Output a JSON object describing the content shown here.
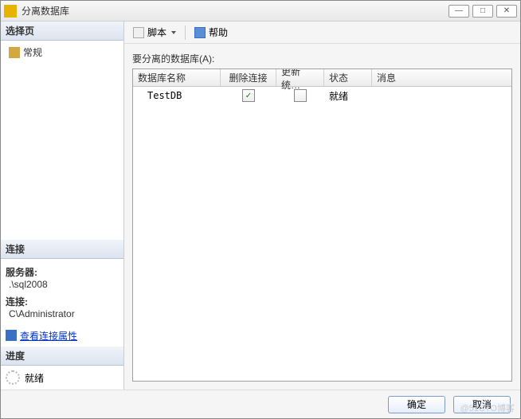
{
  "window": {
    "title": "分离数据库",
    "minimize": "—",
    "maximize": "□",
    "close": "✕"
  },
  "sidebar": {
    "select_page": {
      "header": "选择页",
      "item_general": "常规"
    },
    "connection": {
      "header": "连接",
      "server_label": "服务器:",
      "server_value": ".\\sql2008",
      "conn_label": "连接:",
      "conn_value": "C\\Administrator",
      "view_link": "查看连接属性"
    },
    "progress": {
      "header": "进度",
      "status": "就绪"
    }
  },
  "toolbar": {
    "script_label": "脚本",
    "help_label": "帮助"
  },
  "main": {
    "section_label": "要分离的数据库(A):",
    "columns": {
      "name": "数据库名称",
      "drop": "删除连接",
      "update": "更新统…",
      "status": "状态",
      "message": "消息"
    },
    "rows": [
      {
        "name": "TestDB",
        "drop_checked": true,
        "update_checked": false,
        "status": "就绪",
        "message": ""
      }
    ]
  },
  "footer": {
    "ok": "确定",
    "cancel": "取消"
  },
  "watermark": "@51CTO博客"
}
